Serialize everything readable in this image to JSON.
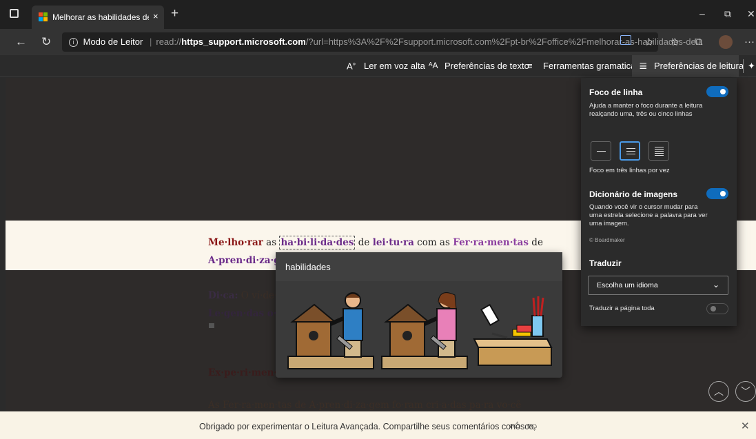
{
  "browser": {
    "tab_title": "Melhorar as habilidades de leitur",
    "tab_close": "×",
    "new_tab": "+",
    "window_controls": {
      "minimize": "–",
      "restore": "⧉",
      "close": "✕"
    },
    "reader_mode_label": "Modo de Leitor",
    "url_prefix": "read://",
    "url_bold": "https_support.microsoft.com",
    "url_rest": "/?url=https%3A%2F%2Fsupport.microsoft.com%2Fpt-br%2Foffice%2Fmelhorar-as-habilidades-de..."
  },
  "reader_toolbar": {
    "read_aloud": "Ler em voz alta",
    "text_prefs": "Preferências de texto",
    "grammar_tools": "Ferramentas gramaticais",
    "reading_prefs": "Preferências de leitura"
  },
  "article": {
    "line1": {
      "w1": "Me·lho·rar",
      "w2": "as",
      "w3": "ha·bi·li·da·des",
      "w4": "de",
      "w5": "lei·tu·ra",
      "w6": "com as",
      "w7": "Fer·ra·men·tas",
      "w8": "de"
    },
    "line2": "A·pren·di·za·g",
    "tip_label": "Di·ca:",
    "tip_text": "O ví·de·",
    "legend": "Le·gen·das o·c",
    "exp": "Ex·pe·ri·men·",
    "bottom_line": "As Fer·ra·men·tas de A·pren·di·za·gem fo·ram cri·a·das pa·ra vo·cê"
  },
  "popup": {
    "word": "habilidades"
  },
  "prefs": {
    "line_focus_title": "Foco de linha",
    "line_focus_desc": "Ajuda a manter o foco durante a leitura realçando uma, três ou cinco linhas",
    "line_focus_caption": "Foco em três linhas por vez",
    "picture_dict_title": "Dicionário de imagens",
    "picture_dict_desc": "Quando você vir o cursor mudar para uma estrela selecione a palavra para ver uma imagem.",
    "boardmaker": "© Boardmaker",
    "translate_title": "Traduzir",
    "language_placeholder": "Escolha um idioma",
    "translate_page": "Traduzir a página toda",
    "line_focus_on": true,
    "picture_dict_on": true,
    "translate_page_on": false
  },
  "feedback_bar": {
    "message": "Obrigado por experimentar o Leitura Avançada. Compartilhe seus comentários conosco."
  },
  "colors": {
    "accent": "#0f6cbd",
    "word_red": "#8a1616",
    "word_purple": "#6b2b8a",
    "focus_band": "#fbf6ec"
  }
}
